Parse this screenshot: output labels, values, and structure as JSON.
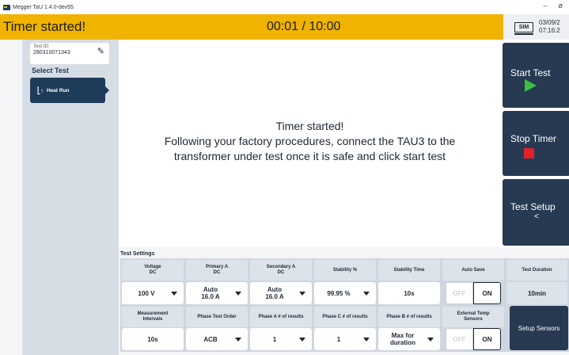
{
  "window": {
    "title": "Megger TaU 1.4.0-dev55",
    "minimize": "–",
    "close": "ø"
  },
  "status": {
    "message": "Timer started!",
    "timer": "00:01 / 10:00",
    "sim_label": "SIM",
    "date": "03/09/2",
    "time": "07:16:2"
  },
  "sidebar": {
    "test_id_label": "Test ID:",
    "test_id_value": "280310071343",
    "select_title": "Select Test",
    "active_test": "Heat Run"
  },
  "main": {
    "line1": "Timer started!",
    "line2": "Following your factory procedures, connect the TAU3 to the",
    "line3": "transformer under test once it is safe and click start test"
  },
  "actions": {
    "start": "Start Test",
    "stop": "Stop Timer",
    "setup": "Test Setup",
    "setup_chevron": "<"
  },
  "colors": {
    "status_bar": "#f0b400",
    "nav_dark": "#273a52",
    "play": "#3fbf3f",
    "stop": "#e0222b"
  },
  "settings": {
    "title": "Test Settings",
    "row1_headers": [
      "Voltage\nDC",
      "Primary A\nDC",
      "Secondary A\nDC",
      "Stability %",
      "Stability Time",
      "Auto Save",
      "Test Duration"
    ],
    "voltage": "100 V",
    "primary_a": "Auto\n16.0 A",
    "secondary_a": "Auto\n16.0 A",
    "stability_pct": "99.95 %",
    "stability_time": "10s",
    "auto_save_off": "OFF",
    "auto_save_on": "ON",
    "test_duration": "10min",
    "row2_headers": [
      "Measurement\nIntervals",
      "Phase Test Order",
      "Phase A # of results",
      "Phase C # of results",
      "Phase B # of results",
      "External Temp\nSensors"
    ],
    "intervals": "10s",
    "phase_order": "ACB",
    "phase_a_results": "1",
    "phase_c_results": "1",
    "phase_b_results": "Max for\nduration",
    "ext_temp_off": "OFF",
    "ext_temp_on": "ON",
    "setup_sensors": "Setup Sensors"
  }
}
